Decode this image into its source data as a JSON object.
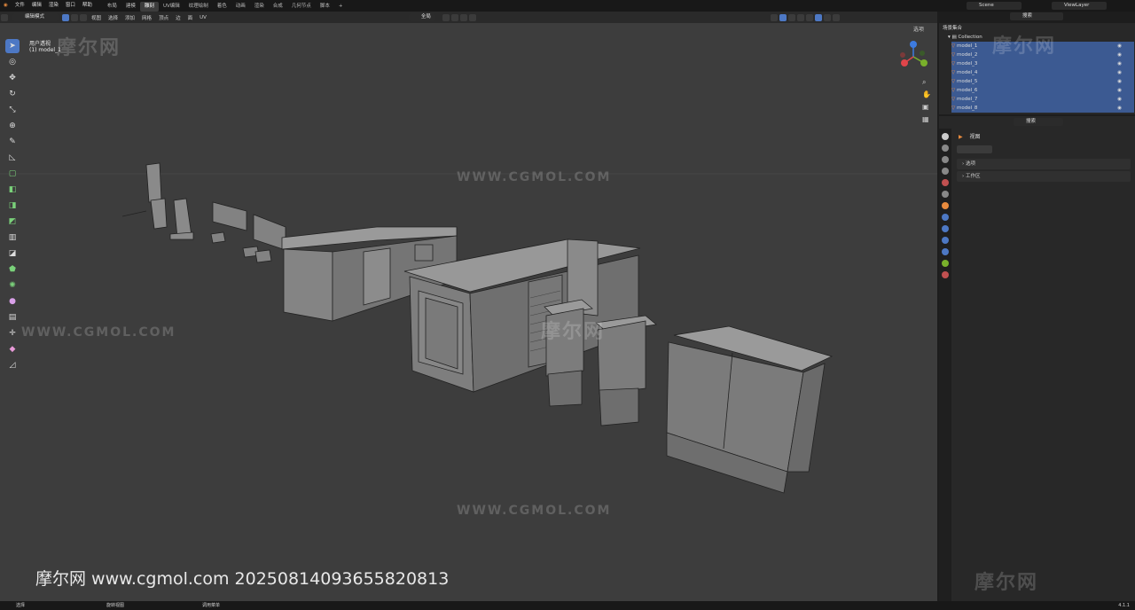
{
  "menu": [
    "文件",
    "编辑",
    "渲染",
    "窗口",
    "帮助"
  ],
  "workspaces": [
    "布局",
    "建模",
    "雕刻",
    "UV编辑",
    "纹理绘制",
    "着色",
    "动画",
    "渲染",
    "合成",
    "几何节点",
    "脚本"
  ],
  "active_workspace": "雕刻",
  "add_tab": "+",
  "scene": {
    "name": "Scene",
    "view_layer": "ViewLayer"
  },
  "viewport_header": {
    "mode": "编辑模式",
    "menus": [
      "视图",
      "选择",
      "添加",
      "网格",
      "顶点",
      "边",
      "面",
      "UV"
    ],
    "transform_orientation": "全局",
    "options": "选项"
  },
  "viewport": {
    "view_name": "用户透视",
    "object_name": "(1) model_1"
  },
  "outliner": {
    "search_placeholder": "搜索",
    "scene_collection": "场景集合",
    "collection": "Collection",
    "items": [
      "model_1",
      "model_2",
      "model_3",
      "model_4",
      "model_5",
      "model_6",
      "model_7",
      "model_8"
    ]
  },
  "properties": {
    "search_placeholder": "搜索",
    "header": "视图",
    "sections": [
      "选项",
      "工作区"
    ]
  },
  "watermarks": {
    "brand_cn": "摩尔网",
    "brand_url": "WWW.CGMOL.COM",
    "footer": "摩尔网 www.cgmol.com 20250814093655820813"
  },
  "statusbar": {
    "left": "选择",
    "middle": "旋转视图",
    "right_hint": "调用菜单",
    "version": "4.1.1"
  },
  "colors": {
    "accent": "#4d78c4",
    "selected_row": "#3c5a92",
    "mesh": "#7a7a7a",
    "axis_x": "#e0454a",
    "axis_y": "#79b02b",
    "axis_z": "#3d7be0"
  }
}
